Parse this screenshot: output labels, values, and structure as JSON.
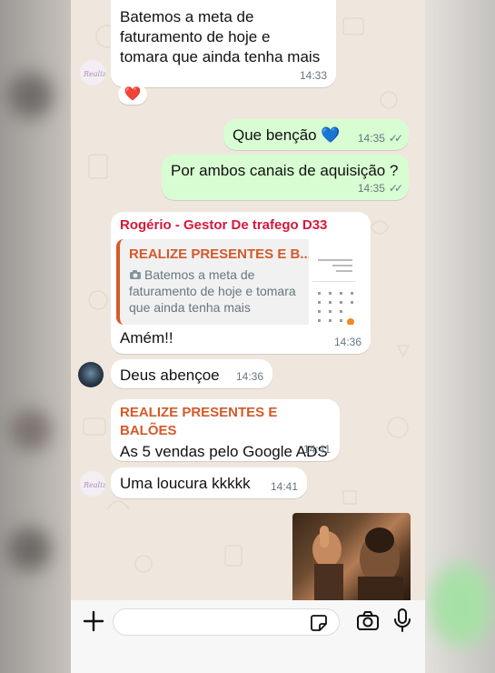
{
  "colors": {
    "chat_bg": "#efe7dd",
    "incoming": "#ffffff",
    "outgoing": "#d8fdd2",
    "sender_red": "#d6183a",
    "brand_orange": "#d35a2b",
    "timestamp": "#667781",
    "read_ticks": "#667781"
  },
  "messages": [
    {
      "direction": "in",
      "text": "Batemos a meta de faturamento de hoje e tomara que ainda tenha mais",
      "lines": [
        "Batemos a meta de",
        "faturamento de hoje e",
        "tomara que ainda tenha mais"
      ],
      "time": "14:33",
      "reaction": "❤️"
    },
    {
      "direction": "out",
      "text": "Que benção 💙",
      "time": "14:35",
      "status": "read"
    },
    {
      "direction": "out",
      "text": "Por ambos canais de aquisição ?",
      "time": "14:35",
      "status": "read"
    },
    {
      "direction": "in",
      "sender": "Rogério - Gestor De trafego D33",
      "quote_author": "REALIZE PRESENTES E B...",
      "quote_icon": "camera-icon",
      "quote_text": "Batemos a meta de faturamento de hoje e tomara que ainda tenha mais",
      "text": "Amém!!",
      "time": "14:36"
    },
    {
      "direction": "in",
      "text": "Deus abençoe",
      "time": "14:36"
    },
    {
      "direction": "in",
      "sender": "REALIZE PRESENTES E BALÕES",
      "text": "As 5 vendas pelo Google ADS",
      "time": "14:41"
    },
    {
      "direction": "in",
      "text": "Uma loucura kkkkk",
      "time": "14:41"
    },
    {
      "direction": "out",
      "type": "image",
      "alt": "thumbs-up-gif"
    }
  ],
  "input_bar": {
    "plus_icon": "plus-icon",
    "sticker_icon": "sticker-icon",
    "camera_icon": "camera-icon",
    "mic_icon": "mic-icon",
    "placeholder": ""
  }
}
